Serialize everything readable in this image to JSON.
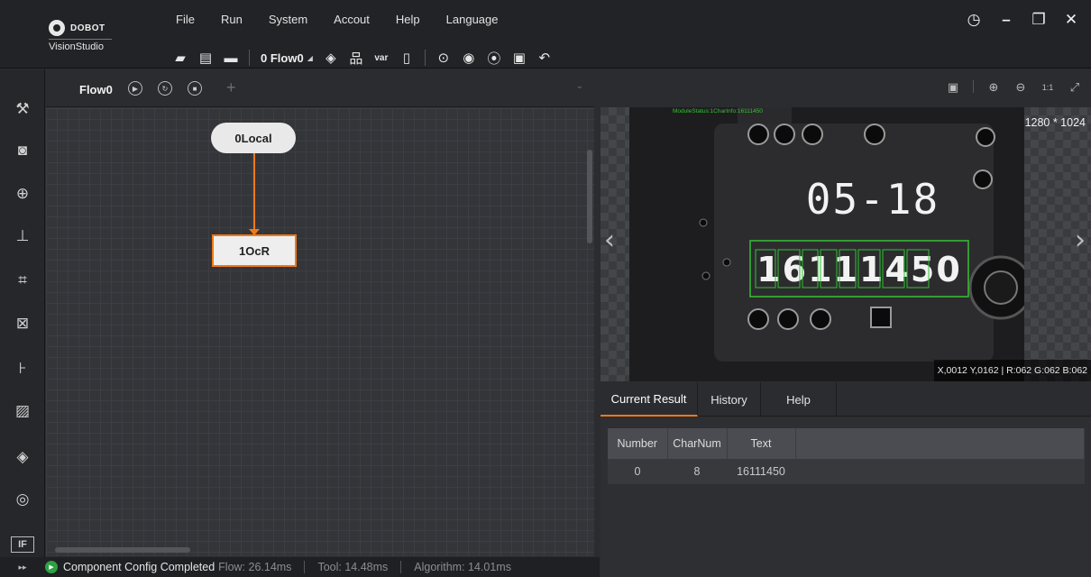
{
  "app": {
    "brand": "DOBOT",
    "product": "VisionStudio"
  },
  "menu": [
    "File",
    "Run",
    "System",
    "Accout",
    "Help",
    "Language"
  ],
  "toolbar": {
    "flow_selector": "0 Flow0"
  },
  "flow_tab": {
    "label": "Flow0"
  },
  "nodes": {
    "local": "0Local",
    "ocr": "1OcR"
  },
  "viewer": {
    "module_status": "ModuleStatus:1CharInfo:16111450",
    "resolution": "1280 * 1024",
    "pixel_info": "X,0012  Y,0162  |  R:062  G:062  B:062",
    "image_date_text": "05-18",
    "image_detected_text": "16111450"
  },
  "result_tabs": [
    "Current Result",
    "History",
    "Help"
  ],
  "result_table": {
    "headers": [
      "Number",
      "CharNum",
      "Text"
    ],
    "rows": [
      [
        "0",
        "8",
        "16111450"
      ]
    ]
  },
  "status": {
    "message": "Component Config Completed",
    "flow": "Flow: 26.14ms",
    "tool": "Tool: 14.48ms",
    "algorithm": "Algorithm: 14.01ms"
  },
  "colors": {
    "accent": "#f07a18",
    "success": "#2ea043",
    "detect_box": "#35c135"
  },
  "icons": {
    "sidebar": [
      "tools-icon",
      "camera-icon",
      "target-icon",
      "measure-icon",
      "recognition-icon",
      "calibration-icon",
      "alignment-icon",
      "image-process-icon",
      "color-icon",
      "defect-icon",
      "logic-if-icon"
    ]
  }
}
